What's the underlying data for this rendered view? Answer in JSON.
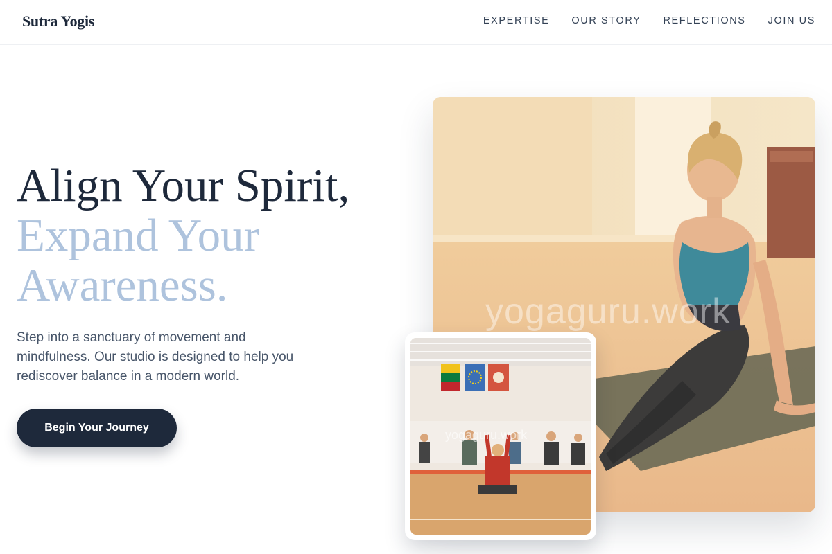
{
  "brand": {
    "name": "Sutra Yogis"
  },
  "nav": {
    "items": [
      {
        "label": "EXPERTISE"
      },
      {
        "label": "OUR STORY"
      },
      {
        "label": "REFLECTIONS"
      },
      {
        "label": "JOIN US"
      }
    ]
  },
  "hero": {
    "headline_line1": "Align Your Spirit,",
    "headline_line2": "Expand Your",
    "headline_line3": "Awareness.",
    "body": "Step into a sanctuary of movement and mindfulness. Our studio is designed to help you rediscover balance in a modern world.",
    "cta_label": "Begin Your Journey"
  },
  "images": {
    "main_watermark": "yogaguru.work",
    "inset_watermark": "yogaguru.work"
  },
  "colors": {
    "navy": "#1e293b",
    "accent_blue": "#aec3dd",
    "body_gray": "#475569"
  }
}
